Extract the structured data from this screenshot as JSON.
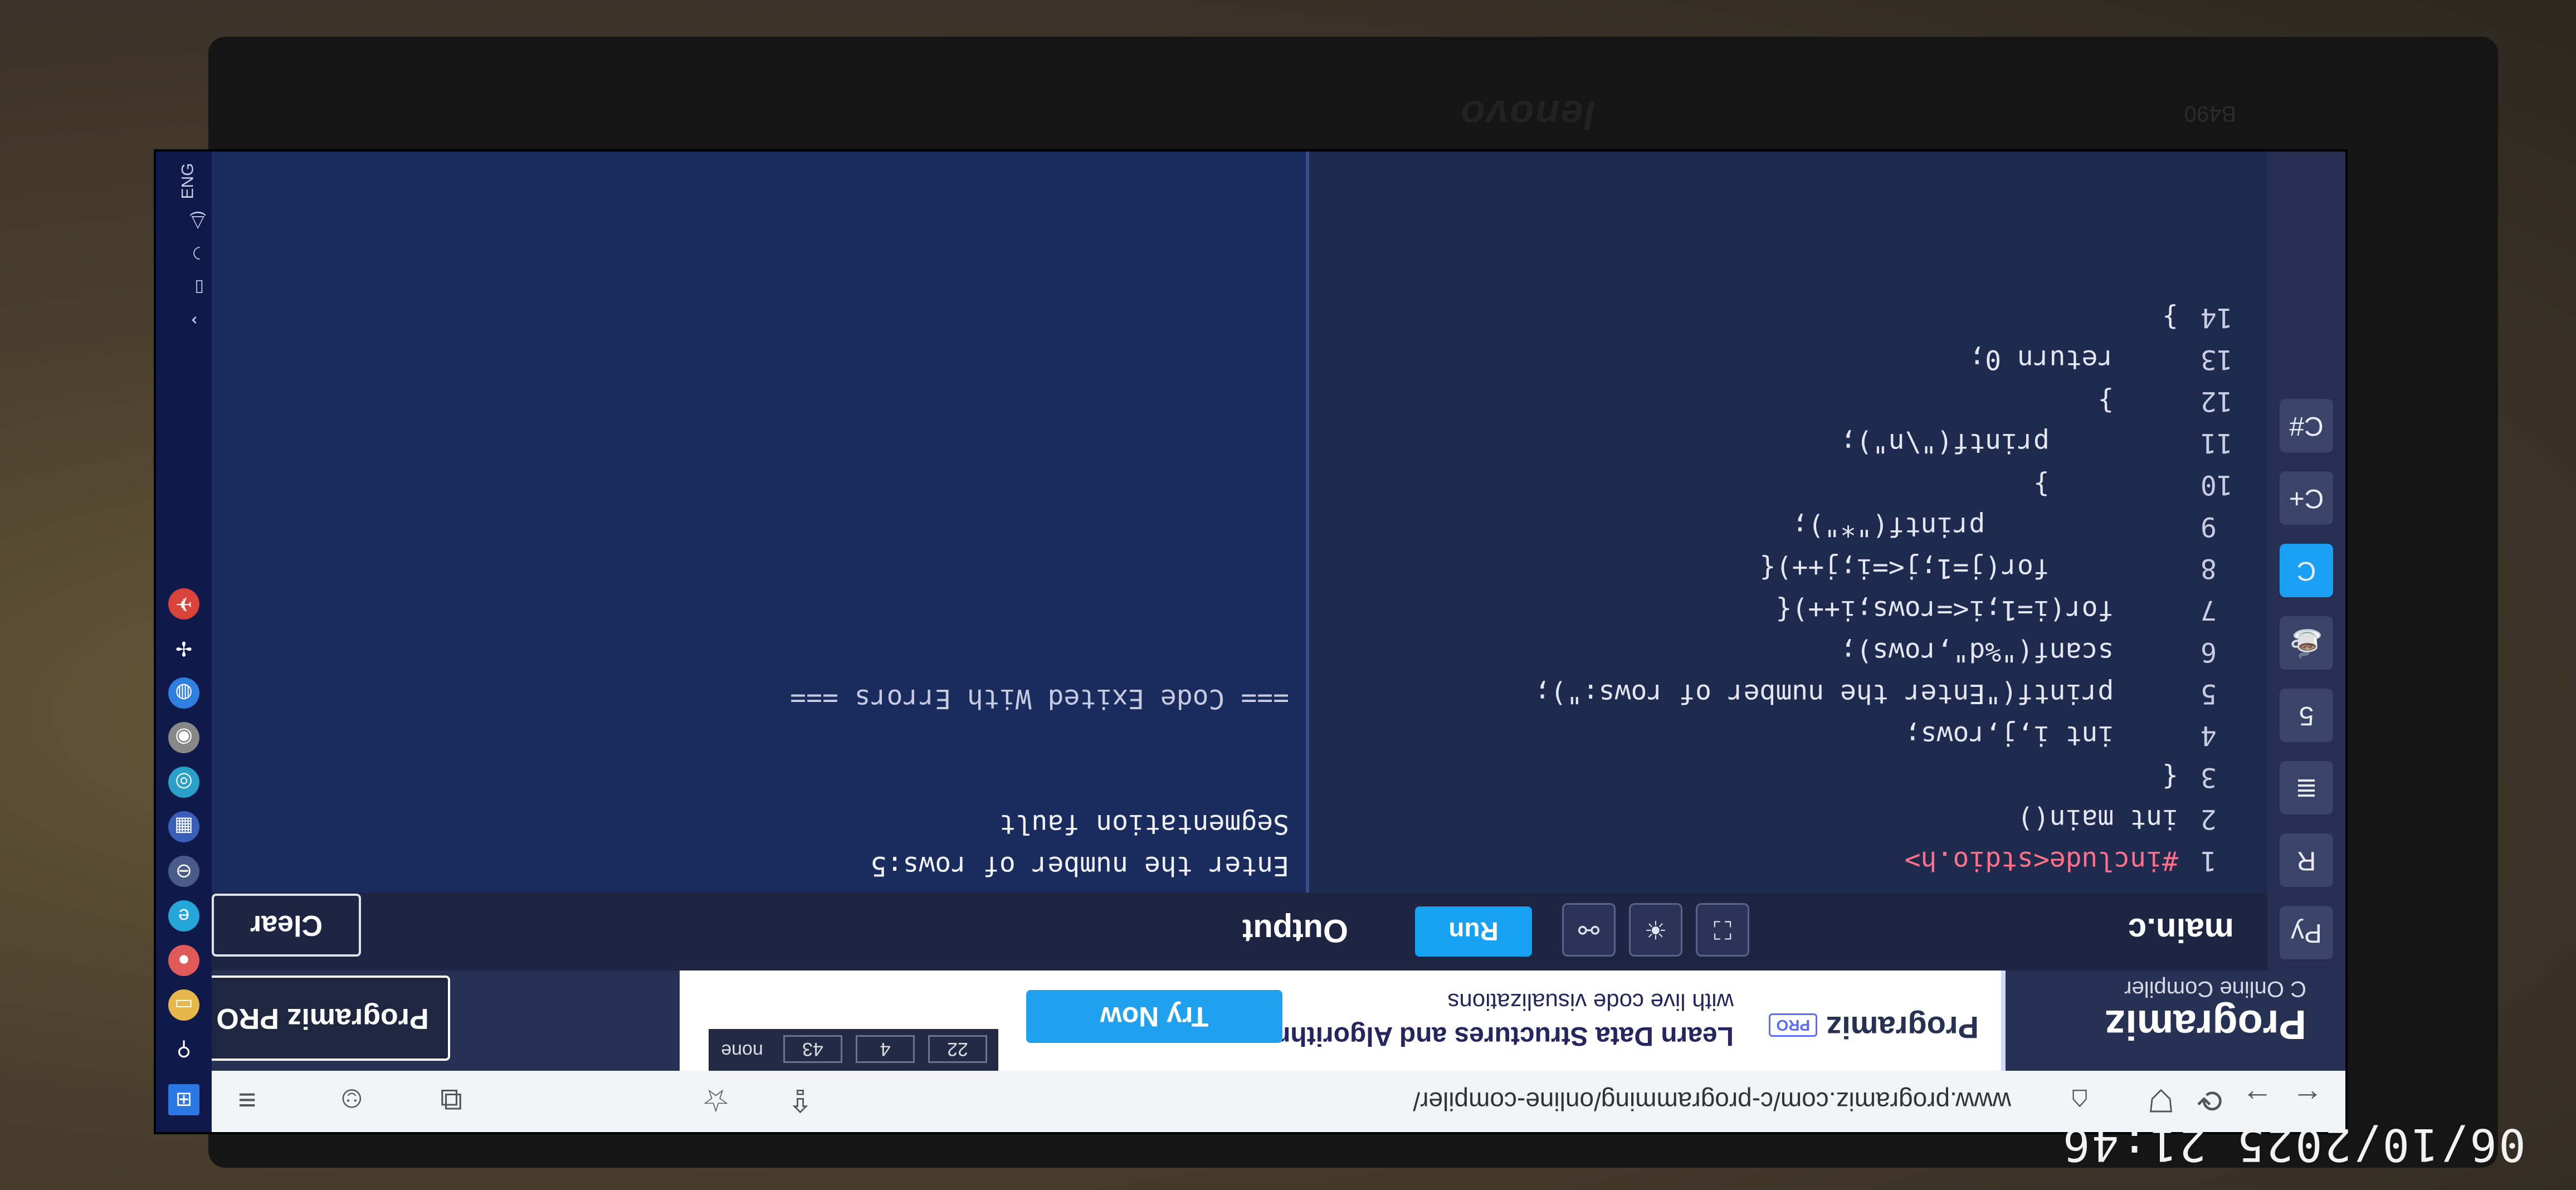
{
  "photo_timestamp": "06/10/2025 21:46",
  "laptop": {
    "brand": "lenovo",
    "model": "B490"
  },
  "browser": {
    "url": "www.programiz.com/c-programming/online-compiler/"
  },
  "header": {
    "logo": "Programiz",
    "subtitle": "C Online Compiler",
    "promo": {
      "brand": "Programiz",
      "pro_badge": "PRO",
      "line1": "Learn Data Structures and Algorithms",
      "line2": "with live code visualizations",
      "cta": "Try Now",
      "viz_nodes": [
        "22",
        "4",
        "43",
        "none"
      ]
    },
    "pro_button": "Programiz PRO"
  },
  "toolbar": {
    "file_tab": "main.c",
    "run_label": "Run",
    "output_label": "Output",
    "clear_label": "Clear"
  },
  "editor": {
    "lines": [
      {
        "n": "1",
        "code": "#include<stdio.h>"
      },
      {
        "n": "2",
        "code": "int main()"
      },
      {
        "n": "3",
        "code": "{"
      },
      {
        "n": "4",
        "code": "    int i,j,rows;"
      },
      {
        "n": "5",
        "code": "    printf(\"Enter the number of rows:\");"
      },
      {
        "n": "6",
        "code": "    scanf(\"%d\",rows);"
      },
      {
        "n": "7",
        "code": "    for(i=1;i<=rows;i++){"
      },
      {
        "n": "8",
        "code": "        for(j=1;j<=i;j++){"
      },
      {
        "n": "9",
        "code": "            printf(\"*\");"
      },
      {
        "n": "10",
        "code": "        }"
      },
      {
        "n": "11",
        "code": "        printf(\"\\n\");"
      },
      {
        "n": "12",
        "code": "    }"
      },
      {
        "n": "13",
        "code": "    return 0;"
      },
      {
        "n": "14",
        "code": "}"
      }
    ]
  },
  "output": {
    "lines": [
      "Enter the number of rows:5",
      "Segmentation fault",
      "",
      "=== Code Exited With Errors ==="
    ]
  },
  "taskbar": {
    "lang": "ENG"
  },
  "colors": {
    "accent": "#1aa0f4",
    "ide_bg": "#1d2749",
    "header_bg": "#273153"
  }
}
